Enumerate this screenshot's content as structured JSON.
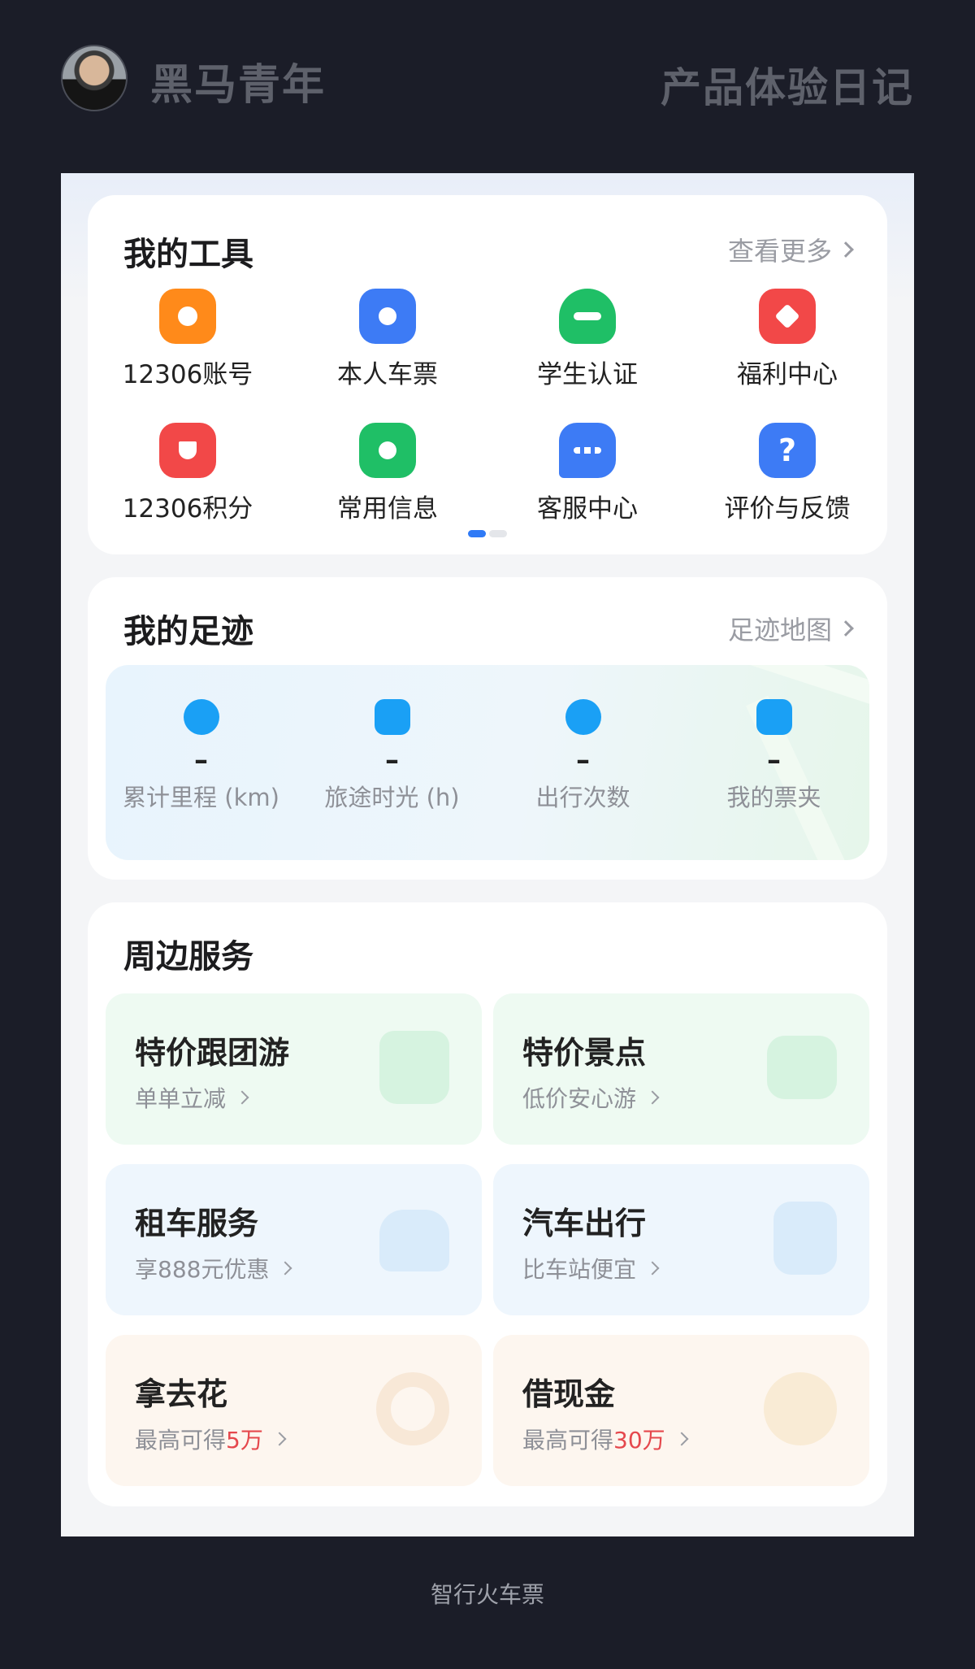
{
  "header": {
    "brand": "黑马青年",
    "diary": "产品体验日记"
  },
  "tools": {
    "title": "我的工具",
    "more": "查看更多",
    "items": [
      {
        "label": "12306账号",
        "icon": "user-badge-icon",
        "color": "#ff8a1a"
      },
      {
        "label": "本人车票",
        "icon": "ticket-person-icon",
        "color": "#3d7bf5"
      },
      {
        "label": "学生认证",
        "icon": "graduation-cap-icon",
        "color": "#1fbf66"
      },
      {
        "label": "福利中心",
        "icon": "gift-star-icon",
        "color": "#f24848"
      },
      {
        "label": "12306积分",
        "icon": "points-wallet-icon",
        "color": "#f24848"
      },
      {
        "label": "常用信息",
        "icon": "contact-card-icon",
        "color": "#1fbf66"
      },
      {
        "label": "客服中心",
        "icon": "chat-bubble-icon",
        "color": "#3d7bf5"
      },
      {
        "label": "评价与反馈",
        "icon": "question-icon",
        "color": "#3d7bf5"
      }
    ]
  },
  "footprint": {
    "title": "我的足迹",
    "more": "足迹地图",
    "items": [
      {
        "value": "–",
        "label": "累计里程 (km)",
        "icon": "compass-icon"
      },
      {
        "value": "–",
        "label": "旅途时光 (h)",
        "icon": "clock-icon"
      },
      {
        "value": "–",
        "label": "出行次数",
        "icon": "planet-icon"
      },
      {
        "value": "–",
        "label": "我的票夹",
        "icon": "ticket-wallet-icon"
      }
    ]
  },
  "services": {
    "title": "周边服务",
    "items": [
      {
        "title": "特价跟团游",
        "sub_prefix": "单单立减",
        "sub_highlight": "",
        "icon": "luggage-icon",
        "bg": "#eefaf2",
        "icon_color": "#c3ecd1"
      },
      {
        "title": "特价景点",
        "sub_prefix": "低价安心游",
        "sub_highlight": "",
        "icon": "scenery-icon",
        "bg": "#eefaf2",
        "icon_color": "#c3ecd1"
      },
      {
        "title": "租车服务",
        "sub_prefix": "享888元优惠",
        "sub_highlight": "",
        "icon": "car-icon",
        "bg": "#eef6fd",
        "icon_color": "#c8e2f7"
      },
      {
        "title": "汽车出行",
        "sub_prefix": "比车站便宜",
        "sub_highlight": "",
        "icon": "bus-icon",
        "bg": "#eef6fd",
        "icon_color": "#c8e2f7"
      },
      {
        "title": "拿去花",
        "sub_prefix": "最高可得",
        "sub_highlight": "5万",
        "icon": "ring-chart-icon",
        "bg": "#fdf6ef",
        "icon_color": "#f4dcc2"
      },
      {
        "title": "借现金",
        "sub_prefix": "最高可得",
        "sub_highlight": "30万",
        "icon": "coin-icon",
        "bg": "#fdf6ef",
        "icon_color": "#f6e2c0"
      }
    ]
  },
  "footer": {
    "app_name": "智行火车票"
  }
}
